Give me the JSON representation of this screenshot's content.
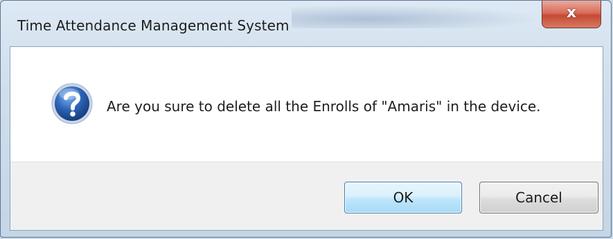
{
  "window": {
    "title": "Time Attendance Management System",
    "close_symbol": "x"
  },
  "dialog": {
    "icon": "question-icon",
    "message": "Are you sure to delete all the Enrolls of \"Amaris\" in the device."
  },
  "buttons": {
    "ok_label": "OK",
    "cancel_label": "Cancel"
  },
  "colors": {
    "close_button": "#c44a34",
    "ok_border": "#3c7fb1",
    "icon_blue": "#2a63b4"
  }
}
